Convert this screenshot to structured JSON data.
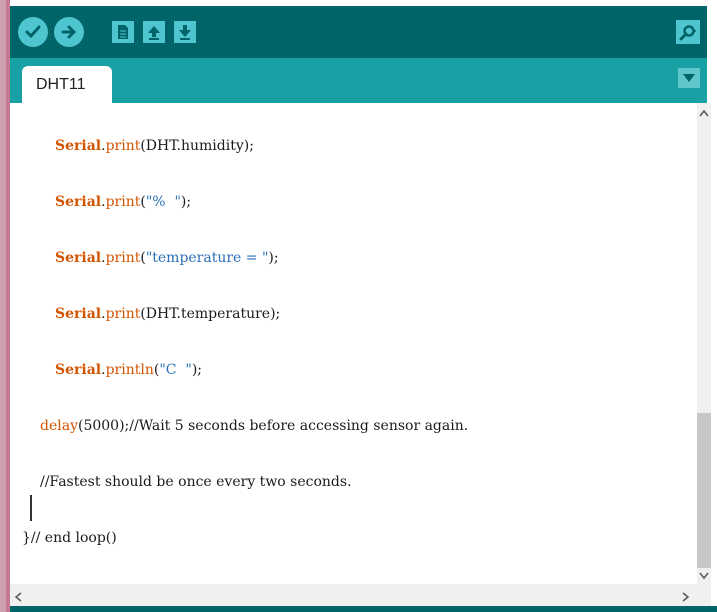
{
  "toolbar": {
    "buttons": [
      {
        "name": "verify",
        "icon": "check-icon"
      },
      {
        "name": "upload",
        "icon": "arrow-right-icon"
      },
      {
        "name": "new",
        "icon": "new-file-icon"
      },
      {
        "name": "open",
        "icon": "arrow-up-icon"
      },
      {
        "name": "save",
        "icon": "arrow-down-icon"
      },
      {
        "name": "serial-monitor",
        "icon": "magnifier-icon"
      }
    ]
  },
  "tabs": [
    {
      "label": "DHT11"
    }
  ],
  "code": {
    "line1": {
      "obj": "Serial",
      "dot": ".",
      "fn": "print",
      "rest": "(DHT.humidity);"
    },
    "line2": {
      "obj": "Serial",
      "dot": ".",
      "fn": "print",
      "open": "(",
      "str": "\"%  \"",
      "close": ");"
    },
    "line3": {
      "obj": "Serial",
      "dot": ".",
      "fn": "print",
      "open": "(",
      "str": "\"temperature = \"",
      "close": ");"
    },
    "line4": {
      "obj": "Serial",
      "dot": ".",
      "fn": "print",
      "rest": "(DHT.temperature);"
    },
    "line5": {
      "obj": "Serial",
      "dot": ".",
      "fn": "println",
      "open": "(",
      "str": "\"C  \"",
      "close": ");"
    },
    "line6": {
      "fn": "delay",
      "rest": "(5000);//Wait 5 seconds before accessing sensor again."
    },
    "line7": {
      "text": "//Fastest should be once every two seconds."
    },
    "line8": {
      "text": "}// end loop()"
    }
  },
  "colors": {
    "toolbar": "#006468",
    "tabbar": "#17a1a5",
    "button": "#4ec5cf",
    "keyword": "#d35400",
    "string": "#2a6fb8"
  }
}
